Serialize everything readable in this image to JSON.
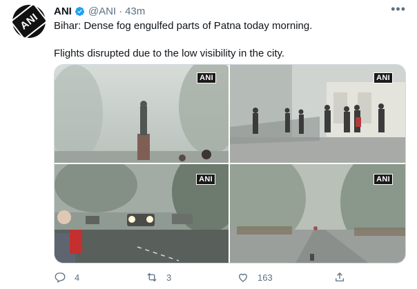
{
  "author": {
    "name": "ANI",
    "handle": "@ANI",
    "separator": "·",
    "time": "43m",
    "avatar_text": "ANI",
    "verified": true
  },
  "tweet": {
    "line1": "Bihar: Dense fog engulfed parts of Patna today morning.",
    "line2": "Flights disrupted due to the low visibility in the city."
  },
  "media": {
    "watermarks": [
      "ANI",
      "ANI",
      "ANI",
      "ANI"
    ]
  },
  "actions": {
    "reply_count": "4",
    "retweet_count": "3",
    "like_count": "163"
  },
  "icons": {
    "more": "more-icon",
    "reply": "reply-icon",
    "retweet": "retweet-icon",
    "like": "heart-icon",
    "share": "share-icon",
    "verified": "verified-badge-icon"
  },
  "colors": {
    "secondary_text": "#5b7083",
    "verified_blue": "#1da1f2",
    "text": "#0f1419"
  }
}
